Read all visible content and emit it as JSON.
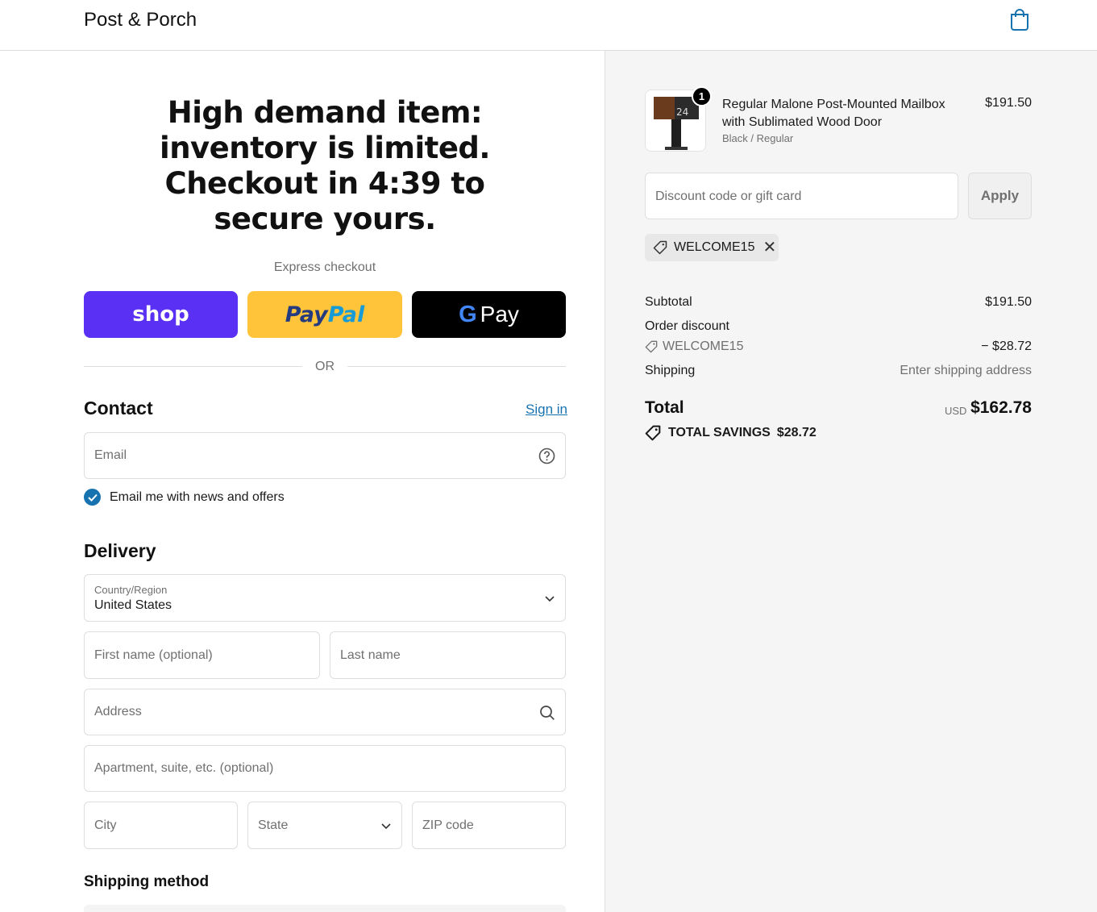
{
  "header": {
    "brand": "Post & Porch",
    "cart_icon": "shopping-bag-icon"
  },
  "promo": {
    "lines": [
      "High demand item:",
      "inventory is limited.",
      "Checkout in 4:39 to",
      "secure yours."
    ]
  },
  "express": {
    "label": "Express checkout",
    "shop_label": "shop",
    "paypal_a": "Pay",
    "paypal_b": "Pal",
    "gpay_g": "G",
    "gpay_label": "Pay",
    "or_label": "OR"
  },
  "contact": {
    "title": "Contact",
    "sign_in": "Sign in",
    "email_placeholder": "Email",
    "newsletter_label": "Email me with news and offers",
    "newsletter_checked": true
  },
  "delivery": {
    "title": "Delivery",
    "country_label": "Country/Region",
    "country_value": "United States",
    "first_name_placeholder": "First name (optional)",
    "last_name_placeholder": "Last name",
    "address_placeholder": "Address",
    "apartment_placeholder": "Apartment, suite, etc. (optional)",
    "city_placeholder": "City",
    "state_placeholder": "State",
    "zip_placeholder": "ZIP code"
  },
  "shipping_method": {
    "title": "Shipping method"
  },
  "summary": {
    "item": {
      "quantity": "1",
      "name": "Regular Malone Post-Mounted Mailbox with Sublimated Wood Door",
      "variant": "Black / Regular",
      "price": "$191.50",
      "thumbnail_number": "24"
    },
    "discount_placeholder": "Discount code or gift card",
    "apply_label": "Apply",
    "applied_code": "WELCOME15",
    "subtotal_label": "Subtotal",
    "subtotal_value": "$191.50",
    "order_discount_label": "Order discount",
    "order_discount_code": "WELCOME15",
    "order_discount_value": "− $28.72",
    "shipping_label": "Shipping",
    "shipping_value": "Enter shipping address",
    "total_label": "Total",
    "currency": "USD",
    "total_value": "$162.78",
    "savings_label": "TOTAL SAVINGS",
    "savings_value": "$28.72"
  },
  "colors": {
    "accent": "#1773b0",
    "shop": "#5a31f4",
    "paypal": "#ffc439",
    "gpay": "#000000"
  }
}
